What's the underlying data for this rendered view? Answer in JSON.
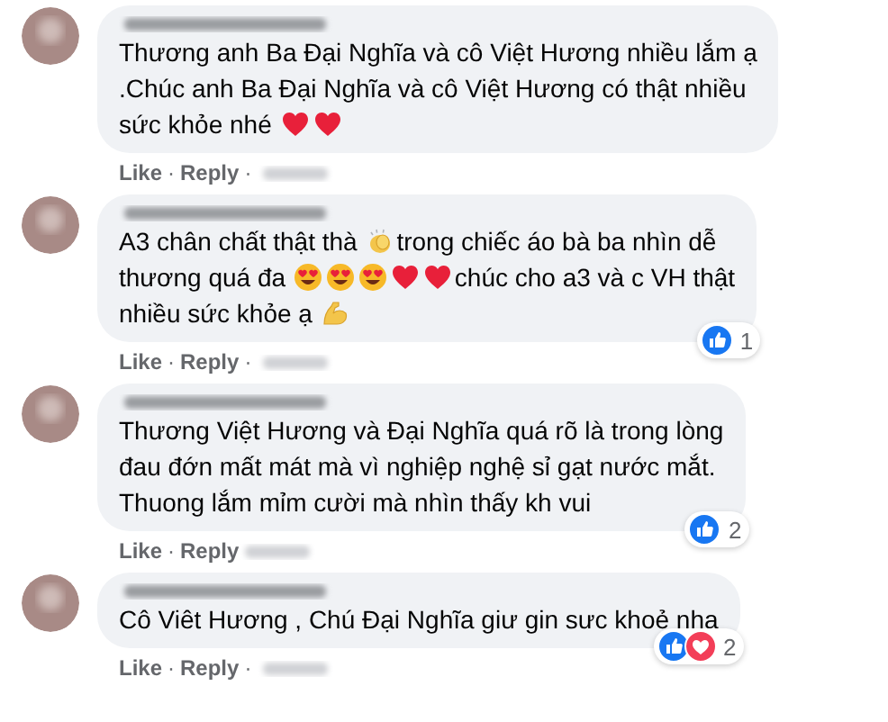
{
  "comments": [
    {
      "lines": [
        [
          {
            "kind": "text",
            "text": "Thương anh Ba Đại Nghĩa và cô Việt Hương nhiều lắm ạ"
          }
        ],
        [
          {
            "kind": "text",
            "text": ".Chúc anh Ba Đại Nghĩa và cô Việt Hương có thật nhiều"
          }
        ],
        [
          {
            "kind": "text",
            "text": "sức khỏe nhé "
          },
          {
            "kind": "heart"
          },
          {
            "kind": "heart"
          }
        ]
      ],
      "actions": [
        {
          "kind": "link",
          "text": "Like"
        },
        {
          "kind": "separator",
          "text": "·"
        },
        {
          "kind": "link",
          "text": "Reply"
        },
        {
          "kind": "separator",
          "text": "·"
        }
      ]
    },
    {
      "lines": [
        [
          {
            "kind": "text",
            "text": "A3 chân chất thật thà "
          },
          {
            "kind": "clap"
          },
          {
            "kind": "text",
            "text": "trong chiếc áo bà ba nhìn dễ"
          }
        ],
        [
          {
            "kind": "text",
            "text": "thương quá đa "
          },
          {
            "kind": "hearteyes"
          },
          {
            "kind": "hearteyes"
          },
          {
            "kind": "hearteyes"
          },
          {
            "kind": "heart"
          },
          {
            "kind": "heart"
          },
          {
            "kind": "text",
            "text": "chúc cho a3 và c VH thật"
          }
        ],
        [
          {
            "kind": "text",
            "text": "nhiều sức khỏe ạ "
          },
          {
            "kind": "muscle"
          }
        ]
      ],
      "actions": [
        {
          "kind": "link",
          "text": "Like"
        },
        {
          "kind": "separator",
          "text": "·"
        },
        {
          "kind": "link",
          "text": "Reply"
        },
        {
          "kind": "separator",
          "text": "·"
        }
      ],
      "reactions": {
        "like": true,
        "count": "1"
      }
    },
    {
      "lines": [
        [
          {
            "kind": "text",
            "text": "Thương Việt Hương và Đại Nghĩa quá rõ là trong lòng"
          }
        ],
        [
          {
            "kind": "text",
            "text": "đau đớn mất mát mà vì nghiệp nghệ sỉ gạt nước mắt."
          }
        ],
        [
          {
            "kind": "text",
            "text": "Thuong lắm mỉm cười mà nhìn thấy kh vui"
          }
        ]
      ],
      "actions": [
        {
          "kind": "link",
          "text": "Like"
        },
        {
          "kind": "separator",
          "text": "·"
        },
        {
          "kind": "link",
          "text": "Reply"
        }
      ],
      "reactions": {
        "like": true,
        "count": "2"
      }
    },
    {
      "lines": [
        [
          {
            "kind": "text",
            "text": "Cô Viêt Hương , Chú Đại Nghĩa giư gin sưc khoẻ nha"
          }
        ]
      ],
      "actions": [
        {
          "kind": "link",
          "text": "Like"
        },
        {
          "kind": "separator",
          "text": "·"
        },
        {
          "kind": "link",
          "text": "Reply"
        },
        {
          "kind": "separator",
          "text": "·"
        }
      ],
      "reactions": {
        "like": true,
        "love": true,
        "count": "2"
      }
    }
  ]
}
